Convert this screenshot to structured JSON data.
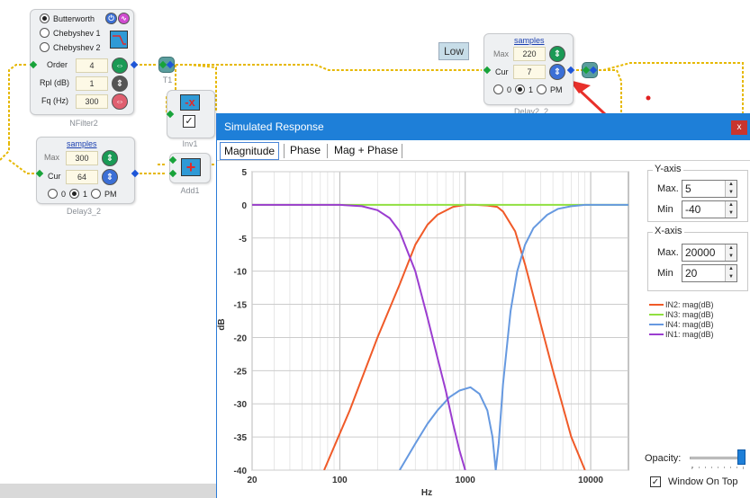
{
  "canvas": {
    "wire_color": "#e6b800",
    "filter_block": {
      "caption": "NFilter2",
      "filter_types": [
        {
          "label": "Butterworth",
          "selected": true
        },
        {
          "label": "Chebyshev 1",
          "selected": false
        },
        {
          "label": "Chebyshev 2",
          "selected": false
        }
      ],
      "order_label": "Order",
      "order_value": "4",
      "rpl_label": "Rpl (dB)",
      "rpl_value": "1",
      "fq_label": "Fq (Hz)",
      "fq_value": "300"
    },
    "delay3_block": {
      "caption": "Delay3_2",
      "samples_link": "samples",
      "max_label": "Max",
      "max_value": "300",
      "cur_label": "Cur",
      "cur_value": "64",
      "radio_labels": [
        "0",
        "1",
        "PM"
      ],
      "radio_selected": "1"
    },
    "delay2_block": {
      "caption": "Delay2_2",
      "samples_link": "samples",
      "max_label": "Max",
      "max_value": "220",
      "cur_label": "Cur",
      "cur_value": "7",
      "radio_labels": [
        "0",
        "1",
        "PM"
      ],
      "radio_selected": "1"
    },
    "t1_caption": "T1",
    "inv_caption": "Inv1",
    "add_caption": "Add1",
    "low_label": "Low",
    "arrow_color": "#e8302a"
  },
  "dialog": {
    "title": "Simulated Response",
    "close_label": "x",
    "tabs": [
      "Magnitude",
      "Phase",
      "Mag + Phase"
    ],
    "active_tab": "Magnitude",
    "yaxis_group": "Y-axis",
    "ymax_label": "Max.",
    "ymax_value": "5",
    "ymin_label": "Min",
    "ymin_value": "-40",
    "xaxis_group": "X-axis",
    "xmax_label": "Max.",
    "xmax_value": "20000",
    "xmin_label": "Min",
    "xmin_value": "20",
    "opacity_label": "Opacity:",
    "opacity_value": 0.95,
    "window_on_top_label": "Window On Top",
    "window_on_top_checked": true
  },
  "chart_data": {
    "type": "line",
    "xlabel": "Hz",
    "ylabel": "dB",
    "xscale": "log",
    "xlim": [
      20,
      20000
    ],
    "ylim": [
      -40,
      5
    ],
    "x_ticks": [
      20,
      100,
      1000,
      10000
    ],
    "x_tick_labels": [
      "20",
      "100",
      "1000",
      "10000"
    ],
    "y_ticks": [
      5,
      0,
      -5,
      -10,
      -15,
      -20,
      -25,
      -30,
      -35,
      -40
    ],
    "grid": true,
    "legend_position": "right",
    "series": [
      {
        "name": "IN2: mag(dB)",
        "color": "#f05a28",
        "x": [
          75,
          120,
          200,
          300,
          400,
          500,
          600,
          800,
          1000,
          1200,
          1500,
          1800,
          2000,
          2500,
          3000,
          4000,
          5000,
          7000,
          9000
        ],
        "y": [
          -40,
          -31,
          -20,
          -12,
          -6,
          -3,
          -1.5,
          -0.3,
          0,
          0,
          -0.1,
          -0.3,
          -1,
          -4,
          -9,
          -18,
          -25,
          -35,
          -40
        ]
      },
      {
        "name": "IN3: mag(dB)",
        "color": "#90e040",
        "x": [
          20,
          100,
          1000,
          10000,
          20000
        ],
        "y": [
          0,
          0,
          0,
          0,
          0
        ]
      },
      {
        "name": "IN4: mag(dB)",
        "color": "#6699e0",
        "x": [
          300,
          400,
          500,
          600,
          750,
          900,
          1100,
          1300,
          1500,
          1650,
          1750,
          1850,
          2000,
          2300,
          2600,
          3000,
          3500,
          4500,
          5500,
          7000,
          9000,
          12000,
          20000
        ],
        "y": [
          -40,
          -36,
          -33,
          -31,
          -29,
          -28,
          -27.5,
          -28.5,
          -31,
          -35,
          -40,
          -36,
          -27,
          -16,
          -10,
          -6,
          -3.5,
          -1.5,
          -0.6,
          -0.2,
          0,
          0,
          0
        ]
      },
      {
        "name": "IN1: mag(dB)",
        "color": "#9b3dd0",
        "x": [
          20,
          100,
          150,
          200,
          250,
          300,
          400,
          500,
          600,
          700,
          800,
          900,
          1000
        ],
        "y": [
          0,
          0,
          -0.2,
          -0.8,
          -2,
          -4,
          -10,
          -17,
          -23,
          -28,
          -33,
          -37,
          -40
        ]
      }
    ]
  }
}
